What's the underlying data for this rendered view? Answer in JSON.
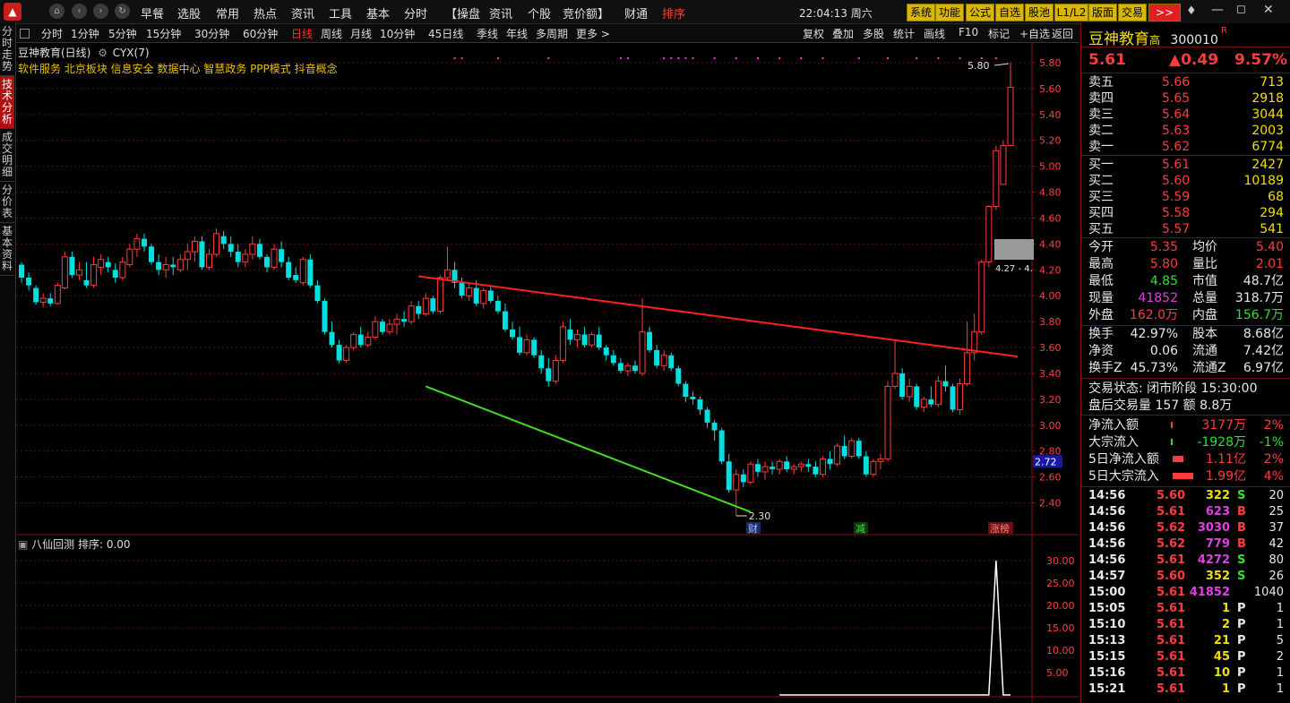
{
  "topbar": {
    "menus": [
      "早餐",
      "选股",
      "常用",
      "热点",
      "资讯",
      "工具",
      "基本",
      "分时",
      "【操盘",
      "资讯",
      "个股",
      "竞价额】",
      "财通",
      "排序"
    ],
    "clock": "22:04:13 周六",
    "buttons": [
      "系统",
      "功能",
      "公式",
      "自选",
      "股池",
      "L1/L2",
      "版面",
      "交易",
      ">>"
    ]
  },
  "left_tabs": [
    "分时走势",
    "技术分析",
    "成交明细",
    "分价表",
    "基本资料"
  ],
  "period_bar": {
    "periods": [
      "分时",
      "1分钟",
      "5分钟",
      "15分钟",
      "30分钟",
      "60分钟",
      "日线",
      "周线",
      "月线",
      "10分钟",
      "45日线",
      "季线",
      "年线",
      "多周期",
      "更多 >"
    ],
    "active": "日线",
    "tools": [
      "复权",
      "叠加",
      "多股",
      "统计",
      "画线",
      "F10",
      "标记",
      "+自选",
      "返回"
    ]
  },
  "chart": {
    "title": "豆神教育(日线)",
    "indicator": "CYX(7)",
    "concepts": "软件服务 北京板块 信息安全 数据中心 智慧政务 PPP模式 抖音概念",
    "price_axis": [
      "5.80",
      "5.60",
      "5.40",
      "5.20",
      "5.00",
      "4.80",
      "4.60",
      "4.40",
      "4.20",
      "4.00",
      "3.80",
      "3.60",
      "3.40",
      "3.20",
      "3.00",
      "2.80",
      "2.60",
      "2.40"
    ],
    "current_price_tag": "2.72",
    "high_label": "5.80",
    "low_label": "2.30",
    "box_label": "4.27 - 4.",
    "markers": [
      "财",
      "减",
      "涨榜"
    ],
    "sub_indicator": "八仙回测 排序: 0.00",
    "sub_axis": [
      "30.00",
      "25.00",
      "20.00",
      "15.00",
      "10.00",
      "5.00"
    ]
  },
  "chart_data": {
    "type": "candlestick",
    "ylim": [
      2.3,
      5.8
    ],
    "high": 5.8,
    "low": 2.3,
    "ohlc": [
      [
        4.24,
        4.26,
        4.1,
        4.14
      ],
      [
        4.14,
        4.18,
        4.04,
        4.08
      ],
      [
        4.06,
        4.08,
        3.93,
        3.95
      ],
      [
        3.95,
        4.02,
        3.91,
        3.98
      ],
      [
        3.98,
        4.02,
        3.92,
        3.94
      ],
      [
        3.94,
        4.1,
        3.93,
        4.08
      ],
      [
        4.06,
        4.34,
        4.05,
        4.3
      ],
      [
        4.3,
        4.34,
        4.14,
        4.16
      ],
      [
        4.16,
        4.26,
        4.12,
        4.2
      ],
      [
        4.12,
        4.26,
        4.06,
        4.08
      ],
      [
        4.08,
        4.3,
        4.06,
        4.24
      ],
      [
        4.22,
        4.32,
        4.16,
        4.28
      ],
      [
        4.26,
        4.3,
        4.18,
        4.22
      ],
      [
        4.2,
        4.25,
        4.1,
        4.14
      ],
      [
        4.14,
        4.3,
        4.12,
        4.26
      ],
      [
        4.24,
        4.4,
        4.22,
        4.36
      ],
      [
        4.36,
        4.48,
        4.3,
        4.44
      ],
      [
        4.44,
        4.48,
        4.34,
        4.38
      ],
      [
        4.38,
        4.4,
        4.24,
        4.26
      ],
      [
        4.26,
        4.32,
        4.16,
        4.2
      ],
      [
        4.2,
        4.3,
        4.14,
        4.24
      ],
      [
        4.24,
        4.3,
        4.16,
        4.22
      ],
      [
        4.2,
        4.32,
        4.18,
        4.28
      ],
      [
        4.28,
        4.4,
        4.2,
        4.34
      ],
      [
        4.34,
        4.46,
        4.26,
        4.42
      ],
      [
        4.42,
        4.46,
        4.2,
        4.22
      ],
      [
        4.22,
        4.36,
        4.2,
        4.32
      ],
      [
        4.32,
        4.52,
        4.3,
        4.48
      ],
      [
        4.46,
        4.5,
        4.36,
        4.4
      ],
      [
        4.4,
        4.46,
        4.3,
        4.34
      ],
      [
        4.34,
        4.4,
        4.22,
        4.26
      ],
      [
        4.26,
        4.36,
        4.22,
        4.32
      ],
      [
        4.32,
        4.46,
        4.28,
        4.4
      ],
      [
        4.4,
        4.44,
        4.28,
        4.3
      ],
      [
        4.3,
        4.32,
        4.18,
        4.22
      ],
      [
        4.22,
        4.4,
        4.2,
        4.36
      ],
      [
        4.36,
        4.42,
        4.22,
        4.26
      ],
      [
        4.26,
        4.3,
        4.12,
        4.14
      ],
      [
        4.16,
        4.22,
        4.1,
        4.12
      ],
      [
        4.1,
        4.3,
        4.08,
        4.28
      ],
      [
        4.28,
        4.32,
        4.06,
        4.08
      ],
      [
        4.08,
        4.12,
        3.94,
        3.96
      ],
      [
        3.96,
        3.98,
        3.7,
        3.72
      ],
      [
        3.72,
        3.8,
        3.6,
        3.62
      ],
      [
        3.62,
        3.66,
        3.48,
        3.5
      ],
      [
        3.5,
        3.62,
        3.48,
        3.6
      ],
      [
        3.6,
        3.72,
        3.58,
        3.7
      ],
      [
        3.7,
        3.76,
        3.6,
        3.62
      ],
      [
        3.62,
        3.72,
        3.6,
        3.68
      ],
      [
        3.68,
        3.84,
        3.66,
        3.8
      ],
      [
        3.8,
        3.82,
        3.7,
        3.72
      ],
      [
        3.72,
        3.82,
        3.7,
        3.78
      ],
      [
        3.78,
        3.86,
        3.7,
        3.82
      ],
      [
        3.82,
        3.88,
        3.76,
        3.8
      ],
      [
        3.8,
        3.96,
        3.78,
        3.92
      ],
      [
        3.92,
        3.96,
        3.82,
        3.86
      ],
      [
        3.86,
        4.02,
        3.84,
        3.98
      ],
      [
        3.98,
        4.0,
        3.86,
        3.88
      ],
      [
        3.88,
        4.16,
        3.86,
        4.14
      ],
      [
        4.14,
        4.38,
        4.12,
        4.2
      ],
      [
        4.2,
        4.26,
        4.06,
        4.1
      ],
      [
        4.1,
        4.14,
        3.98,
        4.0
      ],
      [
        4.0,
        4.1,
        3.96,
        4.06
      ],
      [
        4.06,
        4.12,
        3.92,
        3.94
      ],
      [
        3.94,
        4.06,
        3.9,
        4.04
      ],
      [
        4.04,
        4.08,
        3.94,
        3.96
      ],
      [
        3.96,
        4.0,
        3.86,
        3.88
      ],
      [
        3.88,
        3.94,
        3.72,
        3.74
      ],
      [
        3.74,
        3.8,
        3.66,
        3.68
      ],
      [
        3.68,
        3.76,
        3.54,
        3.56
      ],
      [
        3.56,
        3.7,
        3.54,
        3.66
      ],
      [
        3.66,
        3.68,
        3.52,
        3.54
      ],
      [
        3.54,
        3.58,
        3.4,
        3.44
      ],
      [
        3.44,
        3.52,
        3.3,
        3.34
      ],
      [
        3.34,
        3.54,
        3.32,
        3.5
      ],
      [
        3.5,
        3.8,
        3.48,
        3.76
      ],
      [
        3.74,
        3.82,
        3.62,
        3.66
      ],
      [
        3.66,
        3.74,
        3.6,
        3.7
      ],
      [
        3.7,
        3.76,
        3.6,
        3.62
      ],
      [
        3.62,
        3.72,
        3.6,
        3.7
      ],
      [
        3.7,
        3.76,
        3.58,
        3.6
      ],
      [
        3.6,
        3.62,
        3.5,
        3.54
      ],
      [
        3.54,
        3.58,
        3.46,
        3.48
      ],
      [
        3.48,
        3.52,
        3.4,
        3.42
      ],
      [
        3.42,
        3.48,
        3.38,
        3.46
      ],
      [
        3.46,
        3.5,
        3.4,
        3.42
      ],
      [
        3.4,
        3.98,
        3.38,
        3.72
      ],
      [
        3.72,
        3.76,
        3.56,
        3.58
      ],
      [
        3.58,
        3.62,
        3.44,
        3.46
      ],
      [
        3.46,
        3.58,
        3.42,
        3.54
      ],
      [
        3.54,
        3.56,
        3.42,
        3.44
      ],
      [
        3.44,
        3.46,
        3.3,
        3.32
      ],
      [
        3.32,
        3.34,
        3.18,
        3.22
      ],
      [
        3.22,
        3.26,
        3.16,
        3.2
      ],
      [
        3.2,
        3.22,
        3.08,
        3.12
      ],
      [
        3.12,
        3.14,
        2.98,
        3.02
      ],
      [
        3.02,
        3.04,
        2.88,
        2.96
      ],
      [
        2.96,
        2.98,
        2.7,
        2.72
      ],
      [
        2.72,
        2.78,
        2.48,
        2.5
      ],
      [
        2.5,
        2.66,
        2.3,
        2.62
      ],
      [
        2.62,
        2.66,
        2.52,
        2.56
      ],
      [
        2.56,
        2.72,
        2.54,
        2.7
      ],
      [
        2.7,
        2.74,
        2.6,
        2.64
      ],
      [
        2.64,
        2.72,
        2.58,
        2.68
      ],
      [
        2.68,
        2.72,
        2.62,
        2.66
      ],
      [
        2.66,
        2.74,
        2.62,
        2.72
      ],
      [
        2.72,
        2.76,
        2.64,
        2.66
      ],
      [
        2.66,
        2.7,
        2.62,
        2.68
      ],
      [
        2.68,
        2.72,
        2.64,
        2.7
      ],
      [
        2.7,
        2.74,
        2.64,
        2.68
      ],
      [
        2.68,
        2.72,
        2.6,
        2.62
      ],
      [
        2.62,
        2.76,
        2.6,
        2.74
      ],
      [
        2.74,
        2.8,
        2.66,
        2.7
      ],
      [
        2.7,
        2.86,
        2.68,
        2.84
      ],
      [
        2.84,
        2.92,
        2.74,
        2.76
      ],
      [
        2.76,
        2.9,
        2.74,
        2.88
      ],
      [
        2.88,
        2.9,
        2.74,
        2.76
      ],
      [
        2.76,
        2.8,
        2.6,
        2.62
      ],
      [
        2.62,
        2.74,
        2.6,
        2.72
      ],
      [
        2.72,
        2.78,
        2.66,
        2.74
      ],
      [
        2.74,
        3.34,
        2.72,
        3.3
      ],
      [
        3.3,
        3.66,
        3.28,
        3.4
      ],
      [
        3.4,
        3.44,
        3.2,
        3.22
      ],
      [
        3.22,
        3.36,
        3.18,
        3.3
      ],
      [
        3.3,
        3.32,
        3.12,
        3.14
      ],
      [
        3.14,
        3.22,
        3.1,
        3.2
      ],
      [
        3.2,
        3.3,
        3.14,
        3.16
      ],
      [
        3.16,
        3.38,
        3.14,
        3.34
      ],
      [
        3.34,
        3.46,
        3.26,
        3.3
      ],
      [
        3.3,
        3.32,
        3.1,
        3.12
      ],
      [
        3.12,
        3.36,
        3.08,
        3.32
      ],
      [
        3.32,
        3.8,
        3.3,
        3.56
      ],
      [
        3.56,
        3.86,
        3.5,
        3.72
      ],
      [
        3.72,
        4.28,
        3.7,
        4.26
      ],
      [
        4.26,
        4.7,
        4.22,
        4.69
      ],
      [
        4.69,
        5.16,
        4.66,
        5.12
      ],
      [
        4.86,
        5.2,
        4.86,
        5.16
      ],
      [
        5.16,
        5.8,
        5.16,
        5.61
      ]
    ],
    "downtrend_line": {
      "from": [
        55,
        4.15
      ],
      "to": [
        138,
        3.53
      ]
    },
    "support_line": {
      "from": [
        56,
        3.3
      ],
      "to": [
        101,
        2.33
      ]
    },
    "sub_series": [
      0,
      0,
      0,
      0,
      0,
      0,
      0,
      0,
      0,
      0,
      0,
      0,
      0,
      0,
      0,
      0,
      0,
      0,
      0,
      0,
      0,
      0,
      0,
      0,
      0,
      0,
      0,
      0,
      0,
      0,
      30,
      0,
      0
    ],
    "sub_ylim": [
      0,
      32
    ]
  },
  "quote": {
    "name": "豆神教育",
    "name_suffix": "高",
    "code": "300010",
    "code_flag": "R",
    "price": "5.61",
    "change": "▲0.49",
    "change_pct": "9.57%",
    "sell": [
      {
        "label": "卖五",
        "price": "5.66",
        "vol": "713"
      },
      {
        "label": "卖四",
        "price": "5.65",
        "vol": "2918"
      },
      {
        "label": "卖三",
        "price": "5.64",
        "vol": "3044"
      },
      {
        "label": "卖二",
        "price": "5.63",
        "vol": "2003"
      },
      {
        "label": "卖一",
        "price": "5.62",
        "vol": "6774"
      }
    ],
    "buy": [
      {
        "label": "买一",
        "price": "5.61",
        "vol": "2427"
      },
      {
        "label": "买二",
        "price": "5.60",
        "vol": "10189"
      },
      {
        "label": "买三",
        "price": "5.59",
        "vol": "68"
      },
      {
        "label": "买四",
        "price": "5.58",
        "vol": "294"
      },
      {
        "label": "买五",
        "price": "5.57",
        "vol": "541"
      }
    ],
    "stats": [
      {
        "l1": "今开",
        "v1": "5.35",
        "c1": "red",
        "l2": "均价",
        "v2": "5.40",
        "c2": "red"
      },
      {
        "l1": "最高",
        "v1": "5.80",
        "c1": "red",
        "l2": "量比",
        "v2": "2.01",
        "c2": "red"
      },
      {
        "l1": "最低",
        "v1": "4.85",
        "c1": "green",
        "l2": "市值",
        "v2": "48.7亿",
        "c2": "white"
      },
      {
        "l1": "现量",
        "v1": "41852",
        "c1": "purple",
        "l2": "总量",
        "v2": "318.7万",
        "c2": "white"
      },
      {
        "l1": "外盘",
        "v1": "162.0万",
        "c1": "red",
        "l2": "内盘",
        "v2": "156.7万",
        "c2": "green"
      }
    ],
    "stats2": [
      {
        "l1": "换手",
        "v1": "42.97%",
        "l2": "股本",
        "v2": "8.68亿"
      },
      {
        "l1": "净资",
        "v1": "0.06",
        "l2": "流通",
        "v2": "7.42亿"
      },
      {
        "l1": "换手Z",
        "v1": "45.73%",
        "l2": "流通Z",
        "v2": "6.97亿"
      }
    ],
    "status": "交易状态: 闭市阶段 15:30:00",
    "after_hours": "盘后交易量 157 额 8.8万",
    "flows": [
      {
        "label": "净流入额",
        "value": "3177万",
        "pct": "2%",
        "color": "red",
        "bar": 0.02
      },
      {
        "label": "大宗流入",
        "value": "-1928万",
        "pct": "-1%",
        "color": "green",
        "bar": 0.01
      },
      {
        "label": "5日净流入额",
        "value": "1.11亿",
        "pct": "2%",
        "color": "red",
        "bar": 0.45
      },
      {
        "label": "5日大宗流入",
        "value": "1.99亿",
        "pct": "4%",
        "color": "red",
        "bar": 0.9
      }
    ],
    "ticks": [
      {
        "t": "14:56",
        "p": "5.60",
        "v": "322",
        "s": "S",
        "n": "20",
        "vc": "yellow",
        "sc": "green"
      },
      {
        "t": "14:56",
        "p": "5.61",
        "v": "623",
        "s": "B",
        "n": "25",
        "vc": "purple",
        "sc": "red"
      },
      {
        "t": "14:56",
        "p": "5.62",
        "v": "3030",
        "s": "B",
        "n": "37",
        "vc": "purple",
        "sc": "red"
      },
      {
        "t": "14:56",
        "p": "5.62",
        "v": "779",
        "s": "B",
        "n": "42",
        "vc": "purple",
        "sc": "red"
      },
      {
        "t": "14:56",
        "p": "5.61",
        "v": "4272",
        "s": "S",
        "n": "80",
        "vc": "purple",
        "sc": "green"
      },
      {
        "t": "14:57",
        "p": "5.60",
        "v": "352",
        "s": "S",
        "n": "26",
        "vc": "yellow",
        "sc": "green"
      },
      {
        "t": "15:00",
        "p": "5.61",
        "v": "41852",
        "s": "",
        "n": "1040",
        "vc": "purple",
        "sc": "white"
      },
      {
        "t": "15:05",
        "p": "5.61",
        "v": "1",
        "s": "P",
        "n": "1",
        "vc": "yellow",
        "sc": "white"
      },
      {
        "t": "15:10",
        "p": "5.61",
        "v": "2",
        "s": "P",
        "n": "1",
        "vc": "yellow",
        "sc": "white"
      },
      {
        "t": "15:13",
        "p": "5.61",
        "v": "21",
        "s": "P",
        "n": "5",
        "vc": "yellow",
        "sc": "white"
      },
      {
        "t": "15:15",
        "p": "5.61",
        "v": "45",
        "s": "P",
        "n": "2",
        "vc": "yellow",
        "sc": "white"
      },
      {
        "t": "15:16",
        "p": "5.61",
        "v": "10",
        "s": "P",
        "n": "1",
        "vc": "yellow",
        "sc": "white"
      },
      {
        "t": "15:21",
        "p": "5.61",
        "v": "1",
        "s": "P",
        "n": "1",
        "vc": "yellow",
        "sc": "white"
      }
    ]
  },
  "colors": {
    "up": "#ff3c3c",
    "down": "#00e0e0",
    "trend": "#ff2020",
    "support": "#40e020",
    "accent": "#f0e000"
  }
}
